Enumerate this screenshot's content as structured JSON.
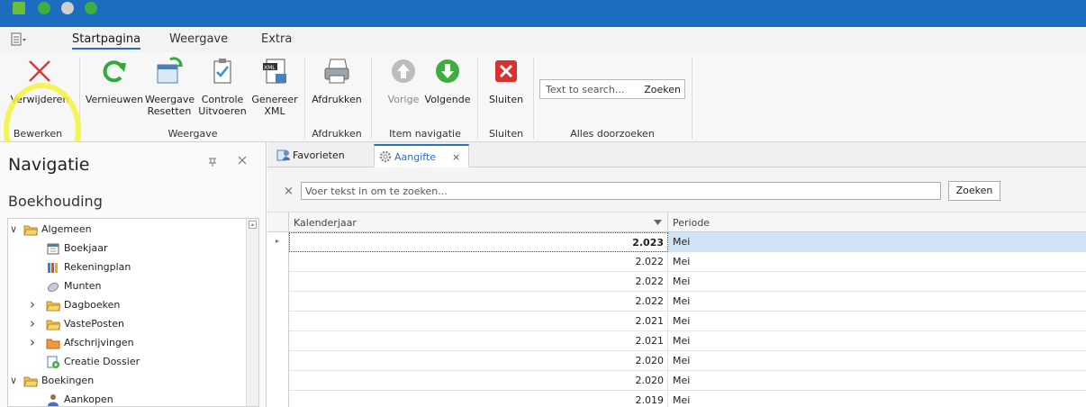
{
  "ribbon": {
    "tabs": [
      "Startpagina",
      "Weergave",
      "Extra"
    ],
    "active_tab": "Startpagina",
    "buttons": {
      "verwijderen": "Verwijderen",
      "vernieuwen": "Vernieuwen",
      "weergave_resetten_1": "Weergave",
      "weergave_resetten_2": "Resetten",
      "controle_1": "Controle",
      "controle_2": "Uitvoeren",
      "genereer_1": "Genereer",
      "genereer_2": "XML",
      "afdrukken": "Afdrukken",
      "vorige": "Vorige",
      "volgende": "Volgende",
      "sluiten": "Sluiten"
    },
    "groups": {
      "bewerken": "Bewerken",
      "weergave": "Weergave",
      "afdrukken": "Afdrukken",
      "item_navigatie": "Item navigatie",
      "sluiten": "Sluiten",
      "alles_doorzoeken": "Alles doorzoeken"
    },
    "search": {
      "placeholder": "Text to search...",
      "button": "Zoeken"
    }
  },
  "navigation": {
    "title": "Navigatie",
    "section": "Boekhouding",
    "tree": [
      {
        "label": "Algemeen",
        "level": 0,
        "expander": "expanded",
        "icon": "folder-icon"
      },
      {
        "label": "Boekjaar",
        "level": 1,
        "expander": "none",
        "icon": "calendar-icon"
      },
      {
        "label": "Rekeningplan",
        "level": 1,
        "expander": "none",
        "icon": "ledger-icon"
      },
      {
        "label": "Munten",
        "level": 1,
        "expander": "none",
        "icon": "coin-icon"
      },
      {
        "label": "Dagboeken",
        "level": 1,
        "expander": "collapsed",
        "icon": "folder-icon"
      },
      {
        "label": "VastePosten",
        "level": 1,
        "expander": "collapsed",
        "icon": "folder-icon"
      },
      {
        "label": "Afschrijvingen",
        "level": 1,
        "expander": "collapsed",
        "icon": "folder-orange-icon"
      },
      {
        "label": "Creatie Dossier",
        "level": 1,
        "expander": "none",
        "icon": "new-dossier-icon"
      },
      {
        "label": "Boekingen",
        "level": 0,
        "expander": "expanded",
        "icon": "folder-icon"
      },
      {
        "label": "Aankopen",
        "level": 1,
        "expander": "none",
        "icon": "user-icon"
      }
    ]
  },
  "doc_tabs": [
    {
      "label": "Favorieten",
      "active": false,
      "icon": "favorites-icon"
    },
    {
      "label": "Aangifte",
      "active": true,
      "icon": "gear-icon",
      "close": "×"
    }
  ],
  "content": {
    "search_placeholder": "Voer tekst in om te zoeken...",
    "search_button": "Zoeken",
    "clear": "×",
    "columns": [
      "Kalenderjaar",
      "Periode"
    ],
    "rows": [
      {
        "jaar": "2.023",
        "periode": "Mei",
        "selected": true
      },
      {
        "jaar": "2.022",
        "periode": "Mei",
        "selected": false
      },
      {
        "jaar": "2.022",
        "periode": "Mei",
        "selected": false
      },
      {
        "jaar": "2.022",
        "periode": "Mei",
        "selected": false
      },
      {
        "jaar": "2.021",
        "periode": "Mei",
        "selected": false
      },
      {
        "jaar": "2.021",
        "periode": "Mei",
        "selected": false
      },
      {
        "jaar": "2.020",
        "periode": "Mei",
        "selected": false
      },
      {
        "jaar": "2.020",
        "periode": "Mei",
        "selected": false
      },
      {
        "jaar": "2.019",
        "periode": "Mei",
        "selected": false
      }
    ]
  },
  "colors": {
    "title_bar": "#1e6cc0",
    "accent": "#2b6cc4",
    "highlight": "#f3f33a",
    "selection": "#cfe3f5"
  }
}
